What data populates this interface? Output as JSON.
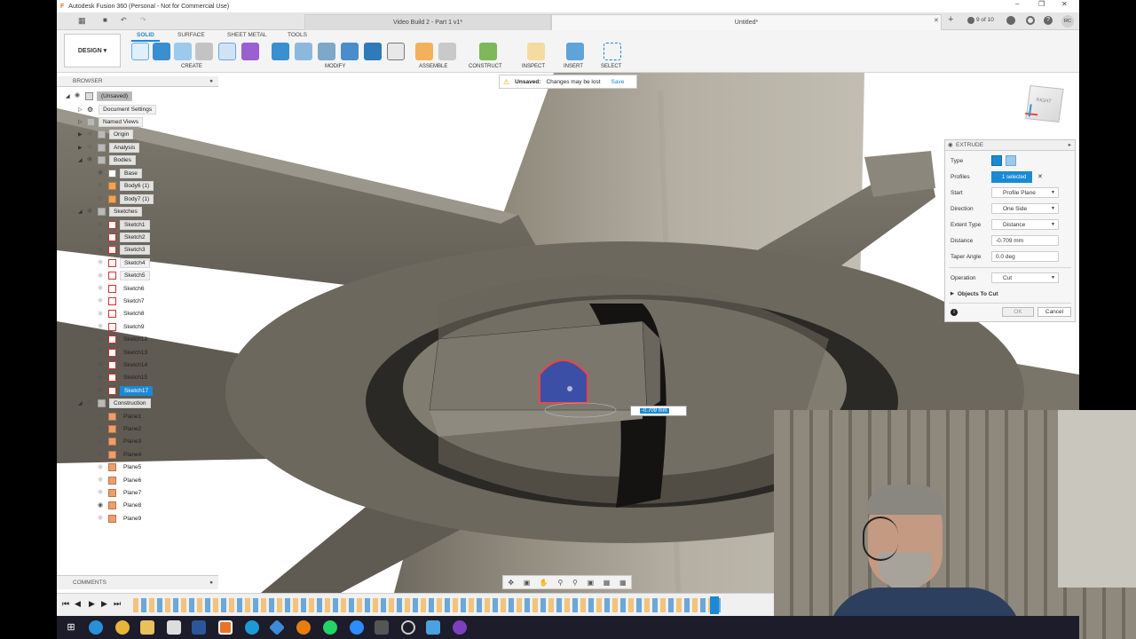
{
  "window": {
    "title": "Autodesk Fusion 360 (Personal - Not for Commercial Use)"
  },
  "tabs": [
    {
      "label": "Video Build 2 - Part 1 v1*"
    },
    {
      "label": "Untitled*"
    }
  ],
  "tab_counter": "9 of 10",
  "user_initials": "RC",
  "toolbar": {
    "workspace": "DESIGN",
    "workspace_tabs": [
      "SOLID",
      "SURFACE",
      "SHEET METAL",
      "TOOLS"
    ],
    "groups": [
      "CREATE",
      "MODIFY",
      "ASSEMBLE",
      "CONSTRUCT",
      "INSPECT",
      "INSERT",
      "SELECT"
    ]
  },
  "banner": {
    "title": "Unsaved:",
    "message": "Changes may be lost",
    "action": "Save"
  },
  "browser": {
    "header": "BROWSER",
    "root": "(Unsaved)",
    "items": [
      {
        "label": "Document Settings",
        "icon": "gear-icon"
      },
      {
        "label": "Named Views",
        "icon": "folder-icon"
      },
      {
        "label": "Origin",
        "icon": "folder-icon"
      },
      {
        "label": "Analysis",
        "icon": "folder-icon"
      },
      {
        "label": "Bodies",
        "icon": "folder-icon"
      }
    ],
    "bodies": [
      "Base",
      "Body6 (1)",
      "Body7 (1)"
    ],
    "sketches_folder": "Sketches",
    "sketches": [
      "Sketch1",
      "Sketch2",
      "Sketch3",
      "Sketch4",
      "Sketch5",
      "Sketch6",
      "Sketch7",
      "Sketch8",
      "Sketch9",
      "Sketch12",
      "Sketch13",
      "Sketch14",
      "Sketch15",
      "Sketch17"
    ],
    "construction_folder": "Construction",
    "planes": [
      "Plane1",
      "Plane2",
      "Plane3",
      "Plane4",
      "Plane5",
      "Plane6",
      "Plane7",
      "Plane8",
      "Plane9"
    ]
  },
  "comments": {
    "label": "COMMENTS"
  },
  "dimension_input": "-0.709 mm",
  "viewcube_label": "RIGHT",
  "extrude": {
    "title": "EXTRUDE",
    "type_label": "Type",
    "profiles_label": "Profiles",
    "profiles_value": "1 selected",
    "start_label": "Start",
    "start_value": "Profile Plane",
    "direction_label": "Direction",
    "direction_value": "One Side",
    "extent_label": "Extent Type",
    "extent_value": "Distance",
    "distance_label": "Distance",
    "distance_value": "-0.709 mm",
    "taper_label": "Taper Angle",
    "taper_value": "0.0 deg",
    "operation_label": "Operation",
    "operation_value": "Cut",
    "objects_label": "Objects To Cut",
    "ok_label": "OK",
    "cancel_label": "Cancel"
  },
  "colors": {
    "accent": "#1a8ad4",
    "model": "#8a8579",
    "taskbar": "#1c1c2a"
  }
}
